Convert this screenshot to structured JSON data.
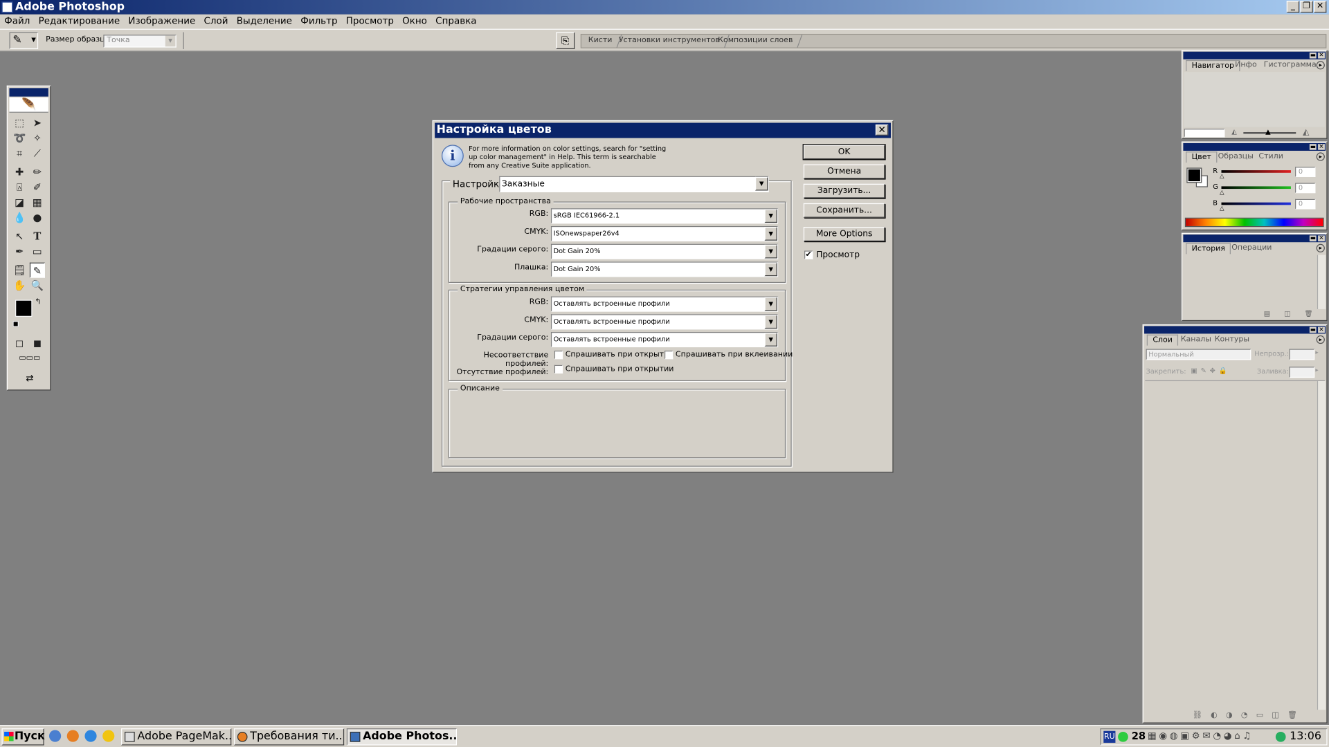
{
  "window": {
    "title": "Adobe Photoshop"
  },
  "menu": [
    "Файл",
    "Редактирование",
    "Изображение",
    "Слой",
    "Выделение",
    "Фильтр",
    "Просмотр",
    "Окно",
    "Справка"
  ],
  "options_bar": {
    "sample_size_label": "Размер образца:",
    "sample_size_value": "Точка",
    "well_tabs": [
      "Кисти",
      "Установки инструментов",
      "Композиции слоев"
    ]
  },
  "dialog": {
    "title": "Настройка цветов",
    "info_text": "For more information on color settings, search for \"setting up color management\" in Help. This term is searchable from any Creative Suite application.",
    "settings_label": "Настройки:",
    "settings_value": "Заказные",
    "working_spaces": {
      "legend": "Рабочие пространства",
      "rows": [
        {
          "label": "RGB:",
          "value": "sRGB IEC61966-2.1"
        },
        {
          "label": "CMYK:",
          "value": "ISOnewspaper26v4"
        },
        {
          "label": "Градации серого:",
          "value": "Dot Gain 20%"
        },
        {
          "label": "Плашка:",
          "value": "Dot Gain 20%"
        }
      ]
    },
    "policies": {
      "legend": "Стратегии управления цветом",
      "rows": [
        {
          "label": "RGB:",
          "value": "Оставлять встроенные профили"
        },
        {
          "label": "CMYK:",
          "value": "Оставлять встроенные профили"
        },
        {
          "label": "Градации серого:",
          "value": "Оставлять встроенные профили"
        }
      ],
      "mismatch_label": "Несоответствие профилей:",
      "mismatch_open": "Спрашивать при открытии",
      "mismatch_paste": "Спрашивать при вклеивании",
      "missing_label": "Отсутствие профилей:",
      "missing_open": "Спрашивать при открытии"
    },
    "description_legend": "Описание",
    "buttons": {
      "ok": "OK",
      "cancel": "Отмена",
      "load": "Загрузить...",
      "save": "Сохранить...",
      "more": "More Options"
    },
    "preview_label": "Просмотр"
  },
  "palettes": {
    "navigator_tabs": [
      "Навигатор",
      "Инфо",
      "Гистограмма"
    ],
    "color_tabs": [
      "Цвет",
      "Образцы",
      "Стили"
    ],
    "color_sliders": [
      {
        "channel": "R",
        "value": "0",
        "color": "#e02020"
      },
      {
        "channel": "G",
        "value": "0",
        "color": "#20c020"
      },
      {
        "channel": "B",
        "value": "0",
        "color": "#2030e0"
      }
    ],
    "history_tabs": [
      "История",
      "Операции"
    ],
    "layers_tabs": [
      "Слои",
      "Каналы",
      "Контуры"
    ],
    "layers_blend": "Нормальный",
    "layers_opacity_label": "Непрозр.:",
    "layers_lock_label": "Закрепить:",
    "layers_fill_label": "Заливка:"
  },
  "taskbar": {
    "start_label": "Пуск",
    "tasks": [
      "Adobe PageMak...",
      "Требования ти...",
      "Adobe Photos..."
    ],
    "lang": "RU",
    "tray_number": "28",
    "clock": "13:06"
  },
  "colors": {
    "title_gradient_start": "#0a246a",
    "title_gradient_end": "#a6caf0",
    "workspace": "#808080",
    "chrome": "#d4d0c8"
  }
}
